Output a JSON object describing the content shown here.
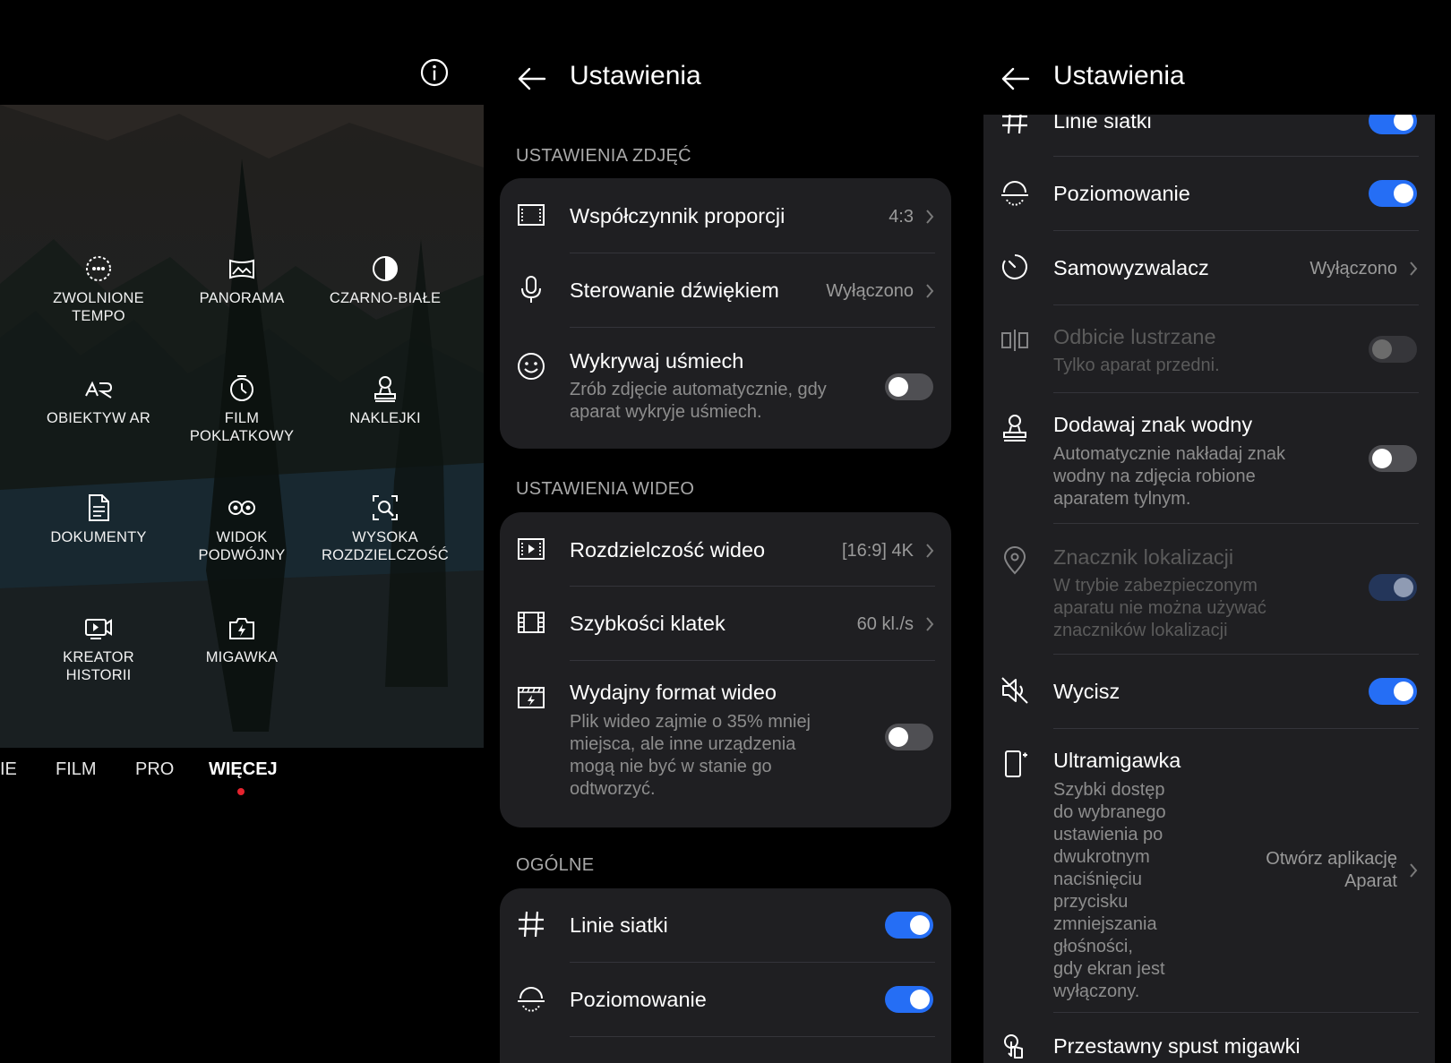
{
  "camera": {
    "modes": [
      {
        "icon": "slow-motion-icon",
        "label": "ZWOLNIONE\nTEMPO"
      },
      {
        "icon": "panorama-icon",
        "label": "PANORAMA"
      },
      {
        "icon": "black-white-icon",
        "label": "CZARNO-BIAŁE"
      },
      {
        "icon": "ar-lens-icon",
        "label": "OBIEKTYW AR"
      },
      {
        "icon": "timelapse-icon",
        "label": "FILM\nPOKLATKOWY"
      },
      {
        "icon": "sticker-icon",
        "label": "NAKLEJKI"
      },
      {
        "icon": "document-icon",
        "label": "DOKUMENTY"
      },
      {
        "icon": "dual-view-icon",
        "label": "WIDOK\nPODWÓJNY"
      },
      {
        "icon": "high-resolution-icon",
        "label": "WYSOKA\nROZDZIELCZOŚĆ"
      },
      {
        "icon": "story-creator-icon",
        "label": "KREATOR\nHISTORII"
      },
      {
        "icon": "snapshot-icon",
        "label": "MIGAWKA"
      }
    ],
    "tabs": [
      "IE",
      "FILM",
      "PRO",
      "WIĘCEJ"
    ],
    "active_tab": "WIĘCEJ"
  },
  "settings_left": {
    "title": "Ustawienia",
    "photo_section": "USTAWIENIA ZDJĘĆ",
    "aspect_ratio": {
      "title": "Współczynnik proporcji",
      "value": "4:3"
    },
    "sound_control": {
      "title": "Sterowanie dźwiękiem",
      "value": "Wyłączono"
    },
    "smile_detect": {
      "title": "Wykrywaj uśmiech",
      "subtitle": "Zrób zdjęcie automatycznie, gdy\naparat wykryje uśmiech.",
      "enabled": false
    },
    "video_section": "USTAWIENIA WIDEO",
    "video_resolution": {
      "title": "Rozdzielczość wideo",
      "value": "[16:9] 4K"
    },
    "frame_rate": {
      "title": "Szybkości klatek",
      "value": "60 kl./s"
    },
    "efficient_format": {
      "title": "Wydajny format wideo",
      "subtitle": "Plik wideo zajmie o 35% mniej\nmiejsca, ale inne urządzenia\nmogą nie być w stanie go\nodtworzyć.",
      "enabled": false
    },
    "general_section": "OGÓLNE",
    "grid_lines": {
      "title": "Linie siatki",
      "enabled": true
    },
    "leveling": {
      "title": "Poziomowanie",
      "enabled": true
    }
  },
  "settings_right": {
    "title": "Ustawienia",
    "grid_lines": {
      "title": "Linie siatki",
      "enabled": true
    },
    "leveling": {
      "title": "Poziomowanie",
      "enabled": true
    },
    "self_timer": {
      "title": "Samowyzwalacz",
      "value": "Wyłączono"
    },
    "mirror": {
      "title": "Odbicie lustrzane",
      "subtitle": "Tylko aparat przedni.",
      "enabled": false
    },
    "watermark": {
      "title": "Dodawaj znak wodny",
      "subtitle": "Automatycznie nakładaj znak\nwodny na zdjęcia robione\naparatem tylnym.",
      "enabled": false
    },
    "location_tag": {
      "title": "Znacznik lokalizacji",
      "subtitle": "W trybie zabezpieczonym\naparatu nie można używać\nznaczników lokalizacji",
      "enabled": true
    },
    "mute": {
      "title": "Wycisz",
      "enabled": true
    },
    "ultra_snapshot": {
      "title": "Ultramigawka",
      "subtitle": "Szybki dostęp\ndo wybranego\nustawienia po\ndwukrotnym\nnaciśnięciu\nprzycisku\nzmniejszania\ngłośności,\ngdy ekran jest\nwyłączony.",
      "value": "Otwórz aplikację\nAparat"
    },
    "movable_shutter": {
      "title": "Przestawny spust migawki"
    }
  },
  "colors": {
    "accent": "#256ef5",
    "card": "#1f1f22",
    "background": "#000000",
    "tab_dot": "#e5232e"
  }
}
